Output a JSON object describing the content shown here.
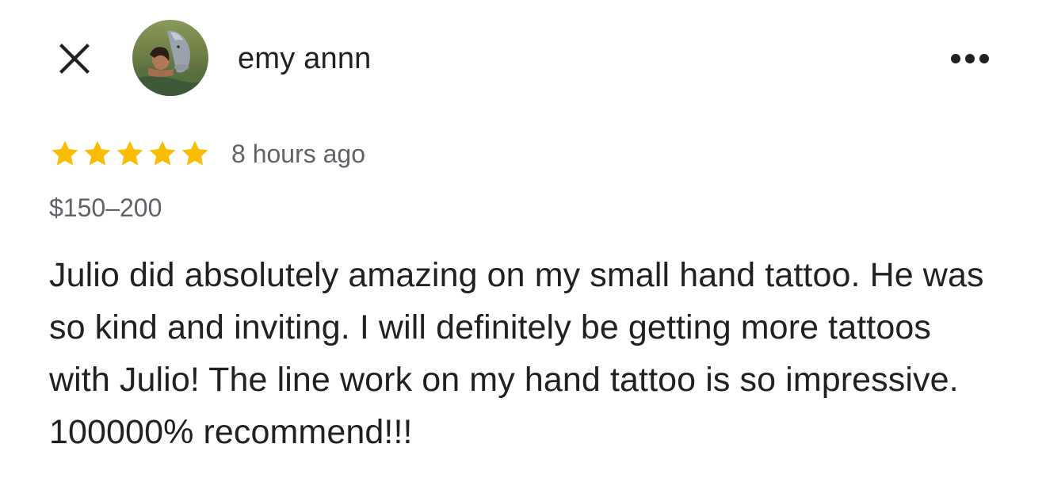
{
  "header": {
    "close_icon": "close-icon",
    "username": "emy annn",
    "avatar_alt": "avatar-photo",
    "more_icon": "more-horizontal-icon"
  },
  "review": {
    "rating": 5,
    "rating_max": 5,
    "star_color": "#fbbc04",
    "time": "8 hours ago",
    "price": "$150–200",
    "text": "Julio did absolutely amazing on my small hand tattoo. He was so kind and inviting. I will definitely be getting more tattoos with Julio! The line work on my hand tattoo is so impressive. 100000% recommend!!!"
  }
}
